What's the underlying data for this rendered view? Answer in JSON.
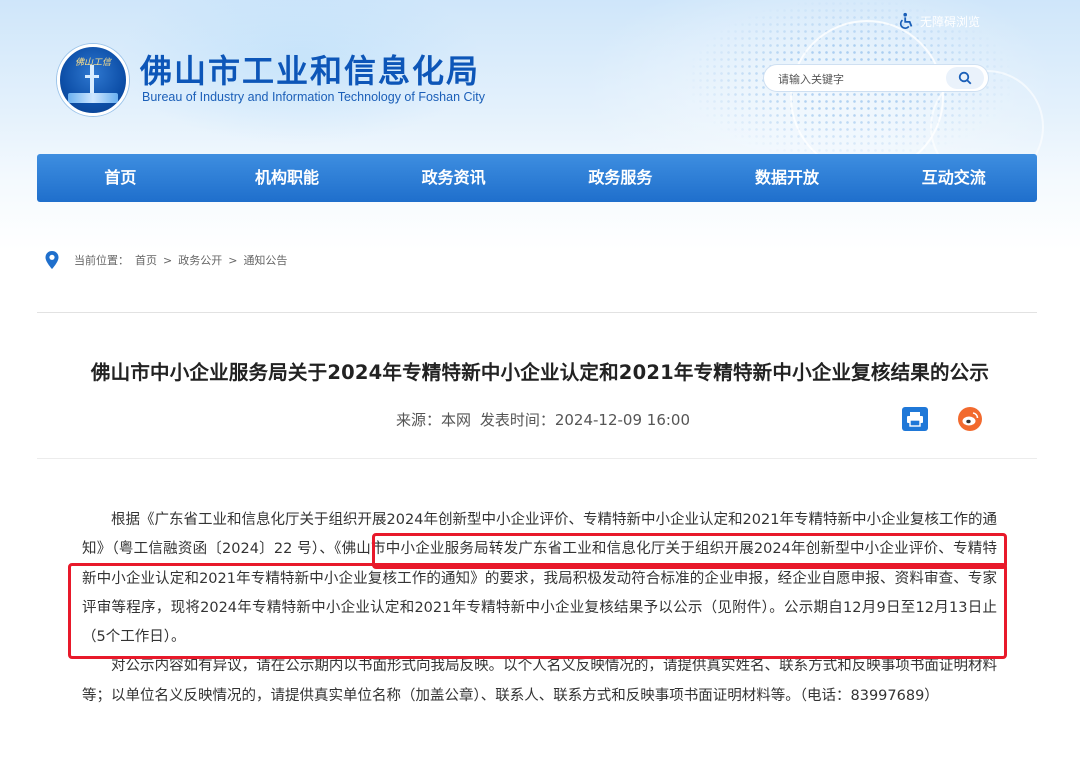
{
  "header": {
    "site_title": "佛山市工业和信息化局",
    "site_subtitle": "Bureau of Industry and Information Technology of Foshan City",
    "logo_text": "佛山工信",
    "accessibility_label": "无障碍浏览",
    "search_placeholder": "请输入关键字"
  },
  "nav": {
    "items": [
      "首页",
      "机构职能",
      "政务资讯",
      "政务服务",
      "数据开放",
      "互动交流"
    ]
  },
  "breadcrumb": {
    "label": "当前位置：",
    "items": [
      "首页",
      "政务公开",
      "通知公告"
    ],
    "separator": ">"
  },
  "article": {
    "title": "佛山市中小企业服务局关于2024年专精特新中小企业认定和2021年专精特新中小企业复核结果的公示",
    "source_label": "来源：",
    "source": "本网",
    "publish_label": "发表时间：",
    "publish_time": "2024-12-09 16:00",
    "paragraph1_part1": "根据《广东省工业和信息化厅关于组织开展2024年创新型中小企业评价、专精特新中小企业认定和2021年专精特新中小企业复核工作的通知》（粤工信融资函〔2024〕22 号）、",
    "paragraph1_part2": "《佛山市中小企业服务局转发广东省工业和信息化厅关于组织开展2024年创新型中小企业评价、专精特新中小企业认定和2021年专精特新中小企业复核工作的通知》的要求，我局积极发动符合标准的企业申报，经企业自愿申报、资料审查、专家评审等程序，现将2024年专精特新中小企业认定和2021年专精特新中小企业复核结果予以公示（见附件）。公示期自12月9日至12月13日止（5个工作日）。",
    "paragraph2": "对公示内容如有异议，请在公示期内以书面形式向我局反映。以个人名义反映情况的，请提供真实姓名、联系方式和反映事项书面证明材料等；以单位名义反映情况的，请提供真实单位名称（加盖公章）、联系人、联系方式和反映事项书面证明材料等。（电话：83997689）"
  },
  "colors": {
    "brand_blue": "#0d56b8",
    "nav_blue": "#1f6fcc",
    "highlight_red": "#e8192a",
    "weibo_orange": "#f26a2e"
  },
  "icons": [
    "accessibility-icon",
    "search-icon",
    "location-pin-icon",
    "print-icon",
    "weibo-icon"
  ]
}
